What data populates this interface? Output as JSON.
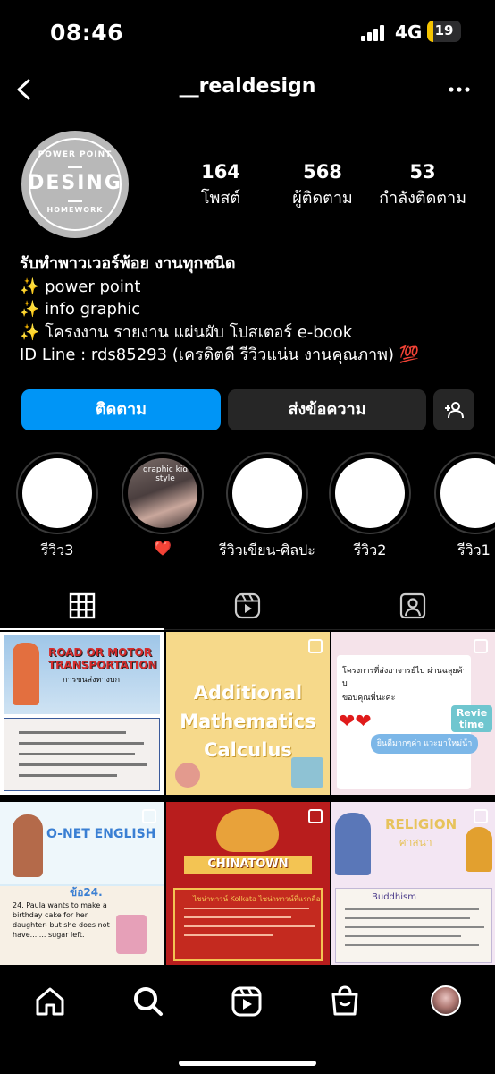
{
  "status_bar": {
    "time": "08:46",
    "network": "4G",
    "battery": "19",
    "battery_level": 0.19,
    "battery_color": "#f5c400"
  },
  "header": {
    "username": "__realdesign",
    "back_icon": "chevron-left-icon",
    "more_icon": "more-horizontal-icon"
  },
  "profile": {
    "avatar": {
      "top_text": "POWER POINT",
      "main_text": "DESING",
      "bottom_text": "HOMEWORK"
    },
    "stats": [
      {
        "value": "164",
        "label": "โพสต์"
      },
      {
        "value": "568",
        "label": "ผู้ติดตาม"
      },
      {
        "value": "53",
        "label": "กำลังติดตาม"
      }
    ],
    "bio": {
      "name": "รับทำพาวเวอร์พ้อย งานทุกชนิด",
      "lines": [
        "✨ power point",
        "✨ info graphic",
        "✨ โครงงาน รายงาน แผ่นผับ โปสเตอร์ e-book",
        "ID Line : rds85293 (เครดิตดี รีวิวแน่น งานคุณภาพ) 💯"
      ]
    }
  },
  "actions": {
    "follow": "ติดตาม",
    "message": "ส่งข้อความ",
    "add_user_icon": "add-person-icon",
    "follow_color": "#0095f6"
  },
  "highlights": [
    {
      "label": "รีวิว3"
    },
    {
      "label": "❤️",
      "photo_caption": "graphic kid style"
    },
    {
      "label": "รีวิวเขียน-ศิลปะ"
    },
    {
      "label": "รีวิว2"
    },
    {
      "label": "รีวิว1"
    }
  ],
  "tabs": [
    {
      "icon": "grid-icon",
      "active": true
    },
    {
      "icon": "reels-icon",
      "active": false
    },
    {
      "icon": "tagged-icon",
      "active": false
    }
  ],
  "posts": {
    "p1": {
      "title_line1": "ROAD OR MOTOR",
      "title_line2": "TRANSPORTATION",
      "subtitle": "การขนส่งทางบก"
    },
    "p2": {
      "line1": "Additional",
      "line2": "Mathematics",
      "line3": "Calculus"
    },
    "p3": {
      "text1": "โครงการที่ส่งอาจารย์ไป ผ่านฉลุยค้าบ",
      "text2": "ขอบคุณพี่นะคะ",
      "bubble": "ยินดีมากๆค่า แวะมาใหม่น้า",
      "badge_line1": "Revie",
      "badge_line2": "time"
    },
    "p4": {
      "title": "O-NET ENGLISH",
      "number": "ข้อ24.",
      "question": "24. Paula wants to make a birthday cake for her daughter- but she does not have....... sugar left."
    },
    "p5": {
      "banner": "CHINATOWN",
      "subtitle": "ไชน่าทาวน์ Kolkata ไชน่าทาวน์ที่แรกคือ"
    },
    "p6": {
      "title": "RELIGION",
      "subtitle": "ศาสนา",
      "section": "Buddhism"
    }
  },
  "bottom_nav": [
    {
      "icon": "home-icon"
    },
    {
      "icon": "search-icon"
    },
    {
      "icon": "reels-icon"
    },
    {
      "icon": "shop-icon"
    },
    {
      "icon": "profile-avatar"
    }
  ]
}
